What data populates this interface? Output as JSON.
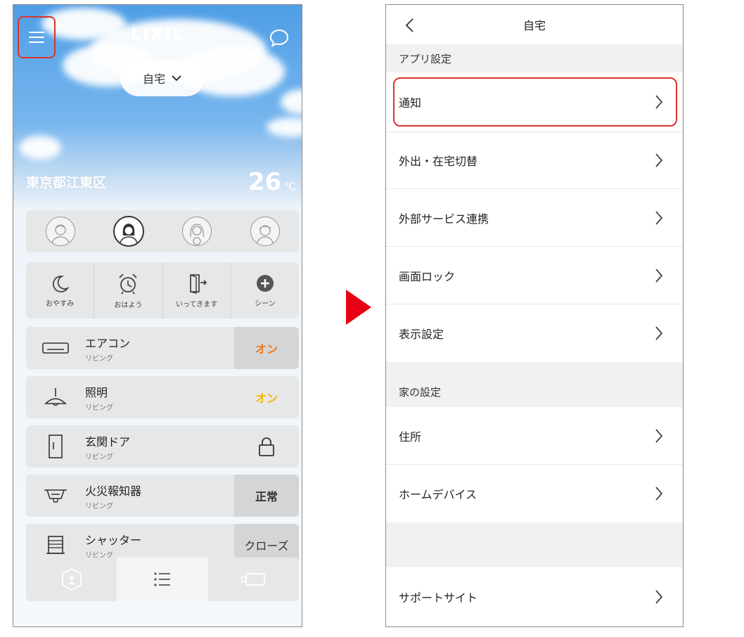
{
  "left": {
    "logo": "LIXIL",
    "home_selector": "自宅",
    "location": "東京都江東区",
    "temperature": "26",
    "temperature_unit": "℃",
    "members": [
      {
        "name": "member-1",
        "active": false
      },
      {
        "name": "member-2",
        "active": true
      },
      {
        "name": "member-3",
        "active": false
      },
      {
        "name": "member-4",
        "active": false
      }
    ],
    "scenes": [
      {
        "label": "おやすみ",
        "icon": "moon-icon"
      },
      {
        "label": "おはよう",
        "icon": "alarm-clock-icon"
      },
      {
        "label": "いってきます",
        "icon": "door-exit-icon"
      },
      {
        "label": "シーン",
        "icon": "plus-circle-icon"
      }
    ],
    "devices": [
      {
        "name": "エアコン",
        "room": "リビング",
        "icon": "air-conditioner-icon",
        "status": "オン",
        "status_color": "#f07a1a"
      },
      {
        "name": "照明",
        "room": "リビング",
        "icon": "ceiling-lamp-icon",
        "status": "オン",
        "status_color": "#f2b600"
      },
      {
        "name": "玄関ドア",
        "room": "リビング",
        "icon": "door-icon",
        "status": "lock-icon",
        "status_color": "#333333"
      },
      {
        "name": "火災報知器",
        "room": "リビング",
        "icon": "smoke-detector-icon",
        "status": "正常",
        "status_color": "#333333"
      },
      {
        "name": "シャッター",
        "room": "リビング",
        "icon": "shutter-icon",
        "status": "クローズ",
        "status_color": "#333333"
      }
    ],
    "nav": [
      {
        "icon": "house-hex-icon"
      },
      {
        "icon": "list-icon"
      },
      {
        "icon": "device-card-icon"
      }
    ]
  },
  "right": {
    "title": "自宅",
    "sections": [
      {
        "header": "アプリ設定",
        "items": [
          "通知",
          "外出・在宅切替",
          "外部サービス連携",
          "画面ロック",
          "表示設定"
        ]
      },
      {
        "header": "家の設定",
        "items": [
          "住所",
          "ホームデバイス"
        ]
      }
    ],
    "support": "サポートサイト"
  },
  "colors": {
    "highlight": "#d9342b",
    "arrow": "#e60012"
  }
}
